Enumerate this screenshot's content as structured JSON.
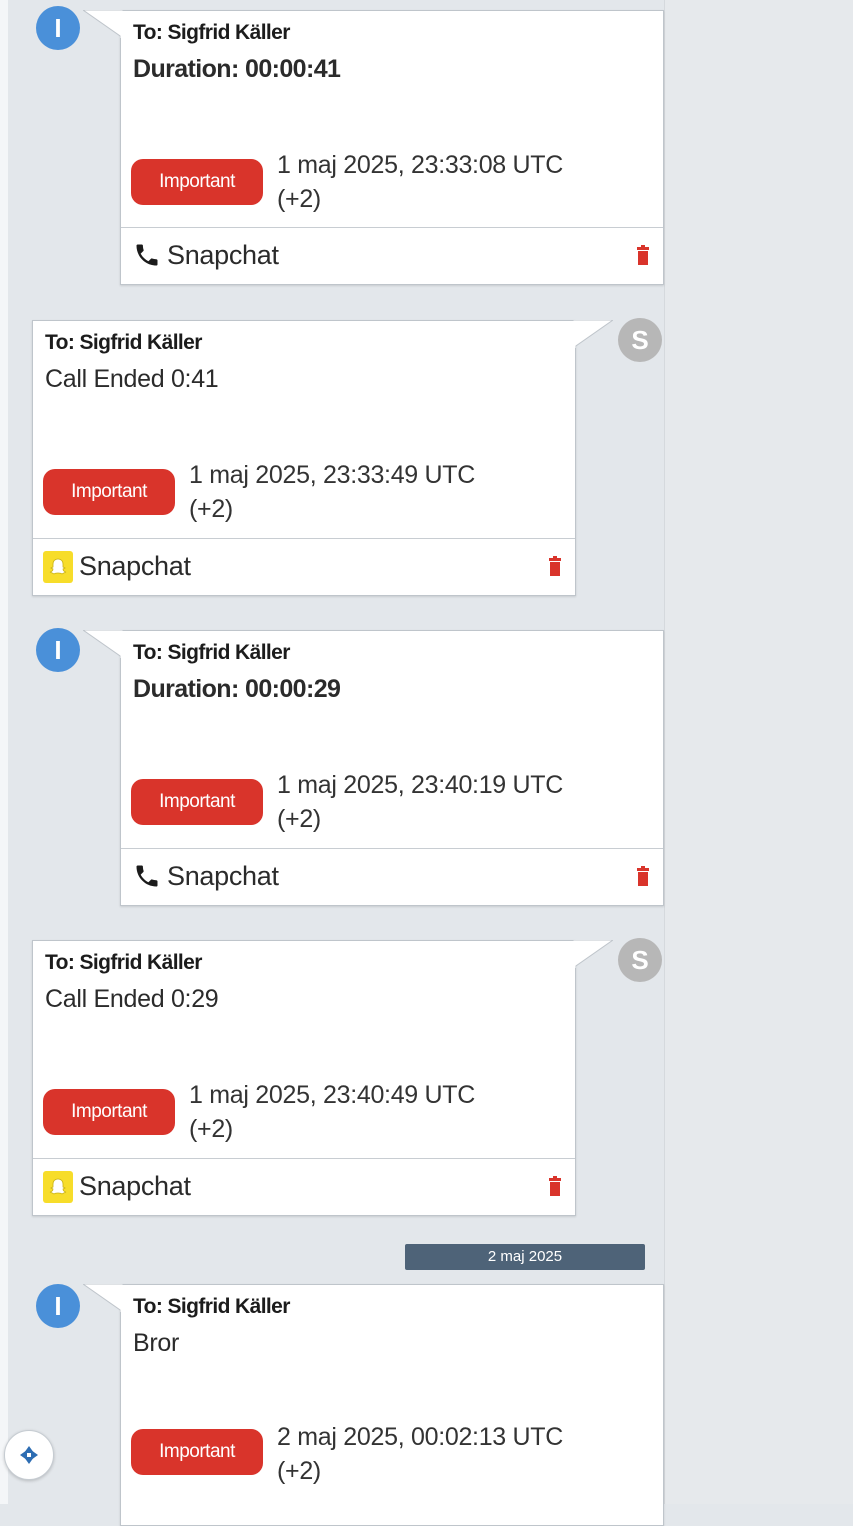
{
  "messages": [
    {
      "recipient": "To: Sigfrid Käller",
      "body": "Duration: 00:00:41",
      "tag": "Important",
      "time_line1": "1 maj 2025, 23:33:08 UTC",
      "time_line2": "(+2)",
      "source": "Snapchat",
      "avatar": "I",
      "direction": "incoming",
      "source_icon": "phone-icon"
    },
    {
      "recipient": "To: Sigfrid Käller",
      "body": "Call Ended 0:41",
      "tag": "Important",
      "time_line1": "1 maj 2025, 23:33:49 UTC",
      "time_line2": "(+2)",
      "source": "Snapchat",
      "avatar": "S",
      "direction": "outgoing",
      "source_icon": "snapchat-icon"
    },
    {
      "recipient": "To: Sigfrid Käller",
      "body": "Duration: 00:00:29",
      "tag": "Important",
      "time_line1": "1 maj 2025, 23:40:19 UTC",
      "time_line2": "(+2)",
      "source": "Snapchat",
      "avatar": "I",
      "direction": "incoming",
      "source_icon": "phone-icon"
    },
    {
      "recipient": "To: Sigfrid Käller",
      "body": "Call Ended 0:29",
      "tag": "Important",
      "time_line1": "1 maj 2025, 23:40:49 UTC",
      "time_line2": "(+2)",
      "source": "Snapchat",
      "avatar": "S",
      "direction": "outgoing",
      "source_icon": "snapchat-icon"
    },
    {
      "recipient": "To: Sigfrid Käller",
      "body": "Bror",
      "tag": "Important",
      "time_line1": "2 maj 2025, 00:02:13 UTC",
      "time_line2": "(+2)",
      "avatar": "I",
      "direction": "incoming"
    }
  ],
  "date_separator": "2 maj 2025",
  "colors": {
    "tag": "#d9342b",
    "avatar_incoming": "#4a90d9",
    "avatar_outgoing": "#b7b7b7",
    "date_separator": "#4e6378",
    "snapchat_yellow": "#f7dd2a"
  }
}
